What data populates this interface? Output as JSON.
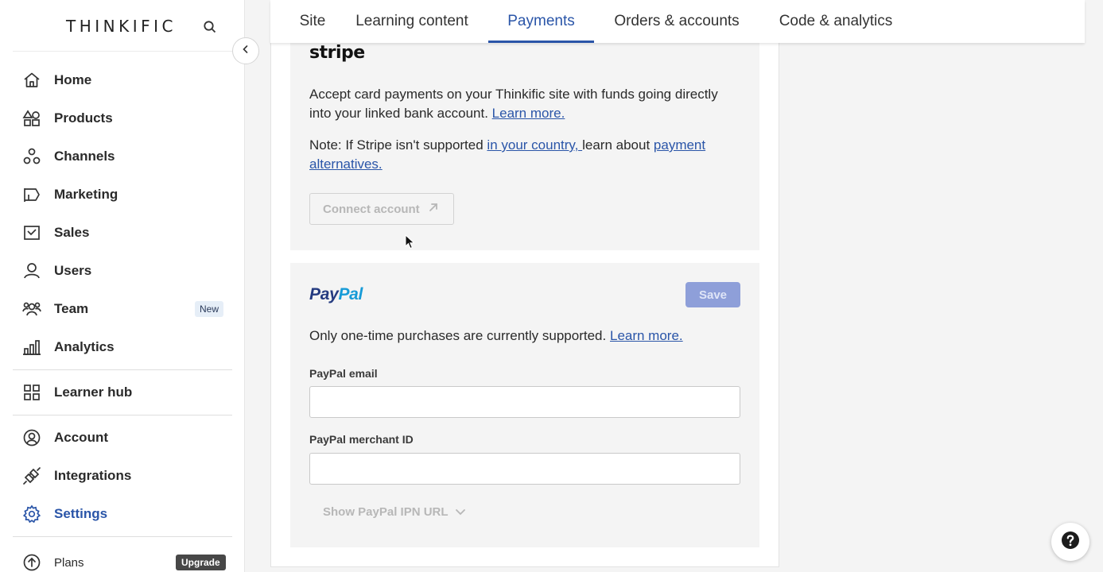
{
  "sidebar": {
    "logo": "THINKIFIC",
    "items": [
      {
        "label": "Home",
        "icon": "home-icon"
      },
      {
        "label": "Products",
        "icon": "products-icon"
      },
      {
        "label": "Channels",
        "icon": "channels-icon"
      },
      {
        "label": "Marketing",
        "icon": "marketing-icon"
      },
      {
        "label": "Sales",
        "icon": "sales-icon"
      },
      {
        "label": "Users",
        "icon": "users-icon"
      },
      {
        "label": "Team",
        "icon": "team-icon",
        "badge": "New"
      },
      {
        "label": "Analytics",
        "icon": "analytics-icon"
      },
      {
        "label": "Learner hub",
        "icon": "learner-hub-icon"
      },
      {
        "label": "Account",
        "icon": "account-icon"
      },
      {
        "label": "Integrations",
        "icon": "integrations-icon"
      },
      {
        "label": "Settings",
        "icon": "gear-icon",
        "active": true
      },
      {
        "label": "Plans",
        "icon": "plans-icon",
        "badge": "Upgrade"
      }
    ]
  },
  "tabs": [
    {
      "label": "Site"
    },
    {
      "label": "Learning content"
    },
    {
      "label": "Payments",
      "active": true
    },
    {
      "label": "Orders & accounts"
    },
    {
      "label": "Code & analytics"
    }
  ],
  "stripe": {
    "logo": "stripe",
    "description": "Accept card payments on your Thinkific site with funds going directly into your linked bank account.",
    "learn_more": "Learn more.",
    "note_prefix": "Note: If Stripe isn't supported ",
    "note_link_country": "in your country, ",
    "note_middle": "learn about ",
    "note_link_alternatives": "payment alternatives.",
    "connect_button": "Connect account"
  },
  "paypal": {
    "logo_pay": "Pay",
    "logo_pal": "Pal",
    "save_button": "Save",
    "description": "Only one-time purchases are currently supported.",
    "learn_more": "Learn more.",
    "email_label": "PayPal email",
    "email_value": "",
    "merchant_label": "PayPal merchant ID",
    "merchant_value": "",
    "ipn_toggle": "Show PayPal IPN URL"
  },
  "colors": {
    "accent": "#2a55a8",
    "save_disabled": "#8e9fd9",
    "paypal_dark": "#253b80",
    "paypal_light": "#179bd7"
  }
}
